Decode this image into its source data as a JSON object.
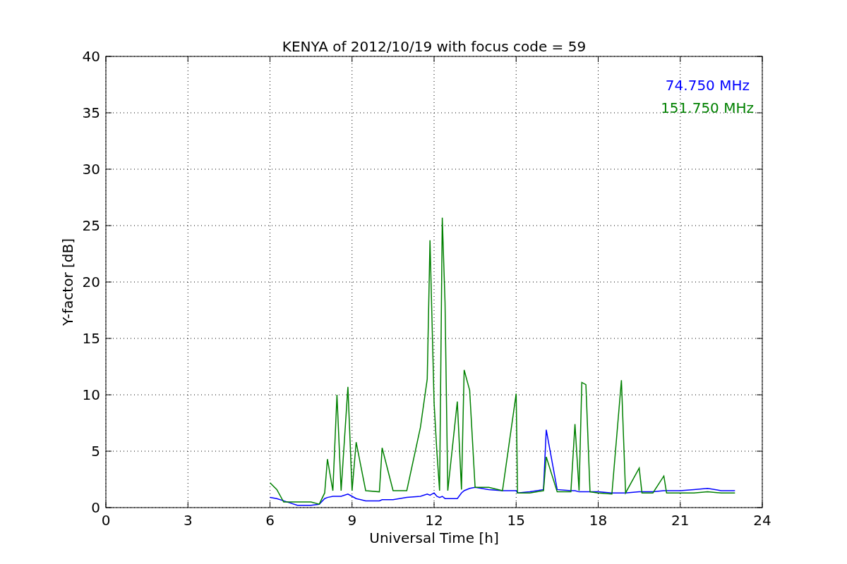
{
  "chart": {
    "chart_data": {
      "type": "line",
      "grid": true,
      "title": "KENYA of 2012/10/19 with focus code = 59",
      "xlabel": "Universal Time [h]",
      "ylabel": "Y-factor [dB]",
      "xlim": [
        0,
        24
      ],
      "ylim": [
        0,
        40
      ],
      "xticks": [
        0,
        3,
        6,
        9,
        12,
        15,
        18,
        21,
        24
      ],
      "yticks": [
        0,
        5,
        10,
        15,
        20,
        25,
        30,
        35,
        40
      ],
      "x": [
        6,
        6.25,
        6.5,
        7,
        7.5,
        7.8,
        8,
        8.1,
        8.3,
        8.45,
        8.6,
        8.85,
        9,
        9.15,
        9.5,
        10,
        10.1,
        10.5,
        11,
        11.5,
        11.75,
        11.85,
        12,
        12.1,
        12.2,
        12.3,
        12.4,
        12.5,
        12.85,
        13,
        13.1,
        13.3,
        13.5,
        14,
        14.5,
        15,
        15.05,
        15.5,
        16,
        16.1,
        16.5,
        17,
        17.15,
        17.3,
        17.4,
        17.55,
        17.7,
        18,
        18.5,
        18.85,
        19,
        19.5,
        19.6,
        20,
        20.4,
        20.5,
        21,
        21.5,
        22,
        22.5,
        23
      ],
      "series": [
        {
          "name": "74.750 MHz",
          "color": "#0000ff",
          "values": [
            0.9,
            0.8,
            0.6,
            0.2,
            0.2,
            0.3,
            0.8,
            0.9,
            1,
            1,
            1,
            1.2,
            1,
            0.8,
            0.6,
            0.6,
            0.7,
            0.7,
            0.9,
            1,
            1.2,
            1.1,
            1.3,
            1,
            0.9,
            1,
            0.8,
            0.8,
            0.8,
            1.3,
            1.5,
            1.7,
            1.8,
            1.6,
            1.5,
            1.5,
            1.3,
            1.4,
            1.6,
            6.9,
            1.6,
            1.5,
            1.5,
            1.4,
            1.4,
            1.4,
            1.4,
            1.4,
            1.3,
            1.3,
            1.3,
            1.4,
            1.4,
            1.4,
            1.5,
            1.5,
            1.5,
            1.6,
            1.7,
            1.5,
            1.5
          ]
        },
        {
          "name": "151.750 MHz",
          "color": "#008000",
          "values": [
            2.2,
            1.6,
            0.5,
            0.5,
            0.5,
            0.3,
            1.3,
            4.3,
            1.5,
            10,
            1.5,
            10.7,
            1.5,
            5.8,
            1.5,
            1.4,
            5.3,
            1.5,
            1.5,
            7.1,
            11.4,
            23.7,
            9.3,
            5,
            1.5,
            25.7,
            18.2,
            1.5,
            9.4,
            1.6,
            12.2,
            10.4,
            1.8,
            1.8,
            1.5,
            10.1,
            1.3,
            1.3,
            1.5,
            4.5,
            1.4,
            1.4,
            7.4,
            1.5,
            11.1,
            10.9,
            1.4,
            1.3,
            1.2,
            11.3,
            1.3,
            3.5,
            1.3,
            1.3,
            2.8,
            1.3,
            1.3,
            1.3,
            1.4,
            1.3,
            1.3
          ]
        }
      ]
    }
  }
}
